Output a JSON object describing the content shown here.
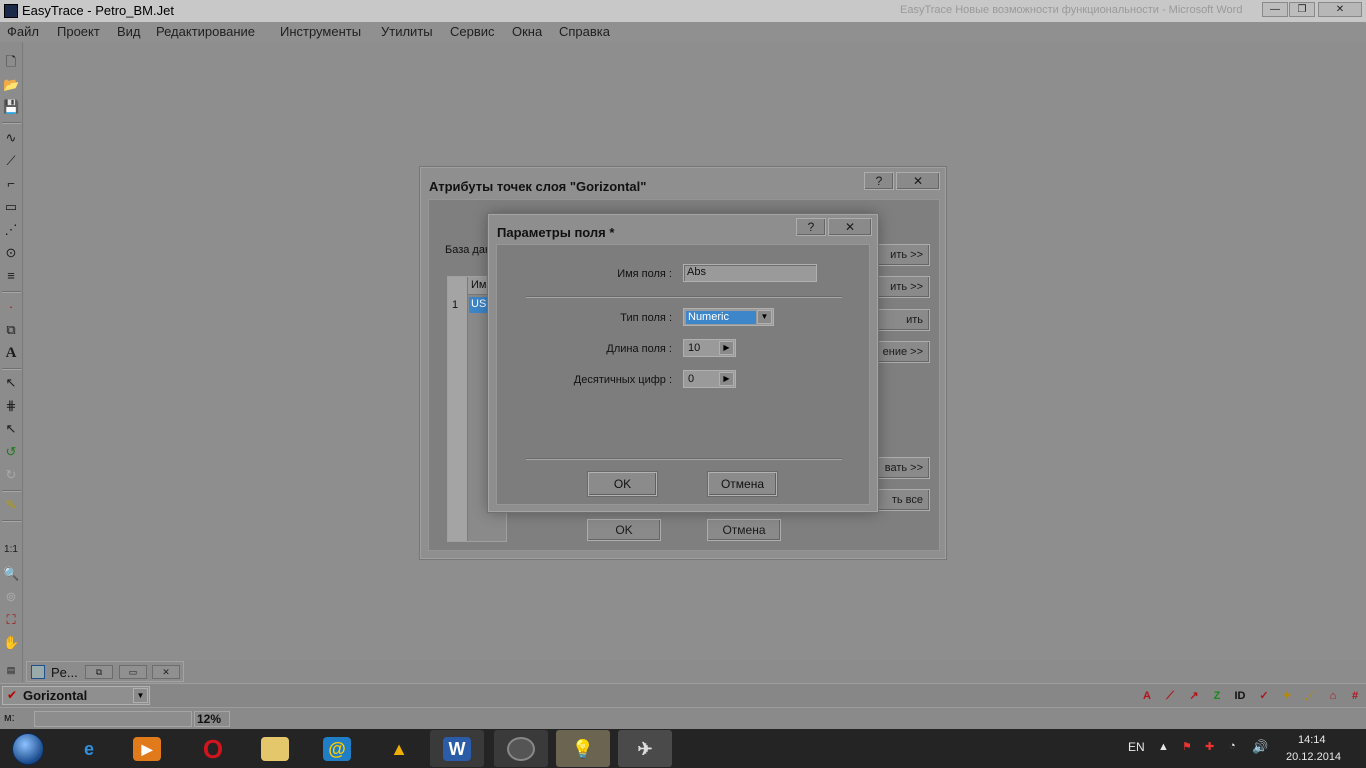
{
  "window": {
    "title": "EasyTrace - Petro_BM.Jet",
    "ghost_title": "EasyTrace Новые возможности функциональности - Microsoft Word"
  },
  "menu": [
    "Файл",
    "Проект",
    "Вид",
    "Редактирование",
    "Инструменты",
    "Утилиты",
    "Сервис",
    "Окна",
    "Справка"
  ],
  "toolbar": {
    "scale_label": "1:1",
    "text_tool": "A"
  },
  "outer_dialog": {
    "title": "Атрибуты точек слоя \"Gorizontal\"",
    "help": "?",
    "close": "✕",
    "db_label": "База данн",
    "grid": {
      "col_header": "Имя",
      "row_number": "1",
      "cell_value": "USEF"
    },
    "side_buttons": [
      "ить >>",
      "ить >>",
      "ить",
      "ение >>",
      "вать >>",
      "ть все"
    ],
    "ok": "OK",
    "cancel": "Отмена"
  },
  "field_dialog": {
    "title": "Параметры поля *",
    "help": "?",
    "close": "✕",
    "name_label": "Имя поля :",
    "name_value": "Abs",
    "type_label": "Тип поля :",
    "type_value": "Numeric",
    "length_label": "Длина поля :",
    "length_value": "10",
    "decimals_label": "Десятичных цифр :",
    "decimals_value": "0",
    "ok": "OK",
    "cancel": "Отмена"
  },
  "mdi_tab": {
    "label": "Pe..."
  },
  "layer": {
    "name": "Gorizontal"
  },
  "status": {
    "m_label": "м:",
    "zoom": "12%"
  },
  "taskbar": {
    "lang": "EN",
    "time": "14:14",
    "date": "20.12.2014"
  },
  "colors": {
    "accent": "#3d86c9",
    "dialog_bg": "#8e8e8e",
    "taskbar_bg": "#242424"
  }
}
